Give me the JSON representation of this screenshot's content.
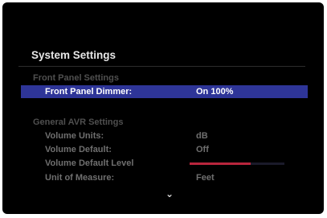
{
  "title": "System Settings",
  "sections": {
    "front_panel": "Front Panel Settings",
    "general_avr": "General AVR Settings"
  },
  "rows": [
    {
      "label": "Front Panel Dimmer:",
      "value": "On 100%"
    },
    {
      "label": "Volume Units:",
      "value": "dB"
    },
    {
      "label": "Volume Default:",
      "value": "Off"
    },
    {
      "label": "Volume Default Level",
      "value": ""
    },
    {
      "label": "Unit of Measure:",
      "value": "Feet"
    }
  ],
  "volume_default_level_fraction": 0.64,
  "scroll_indicator_icon": "chevron-down-icon",
  "colors": {
    "highlight": "#2e3598",
    "level_bar": "#b8253d"
  }
}
